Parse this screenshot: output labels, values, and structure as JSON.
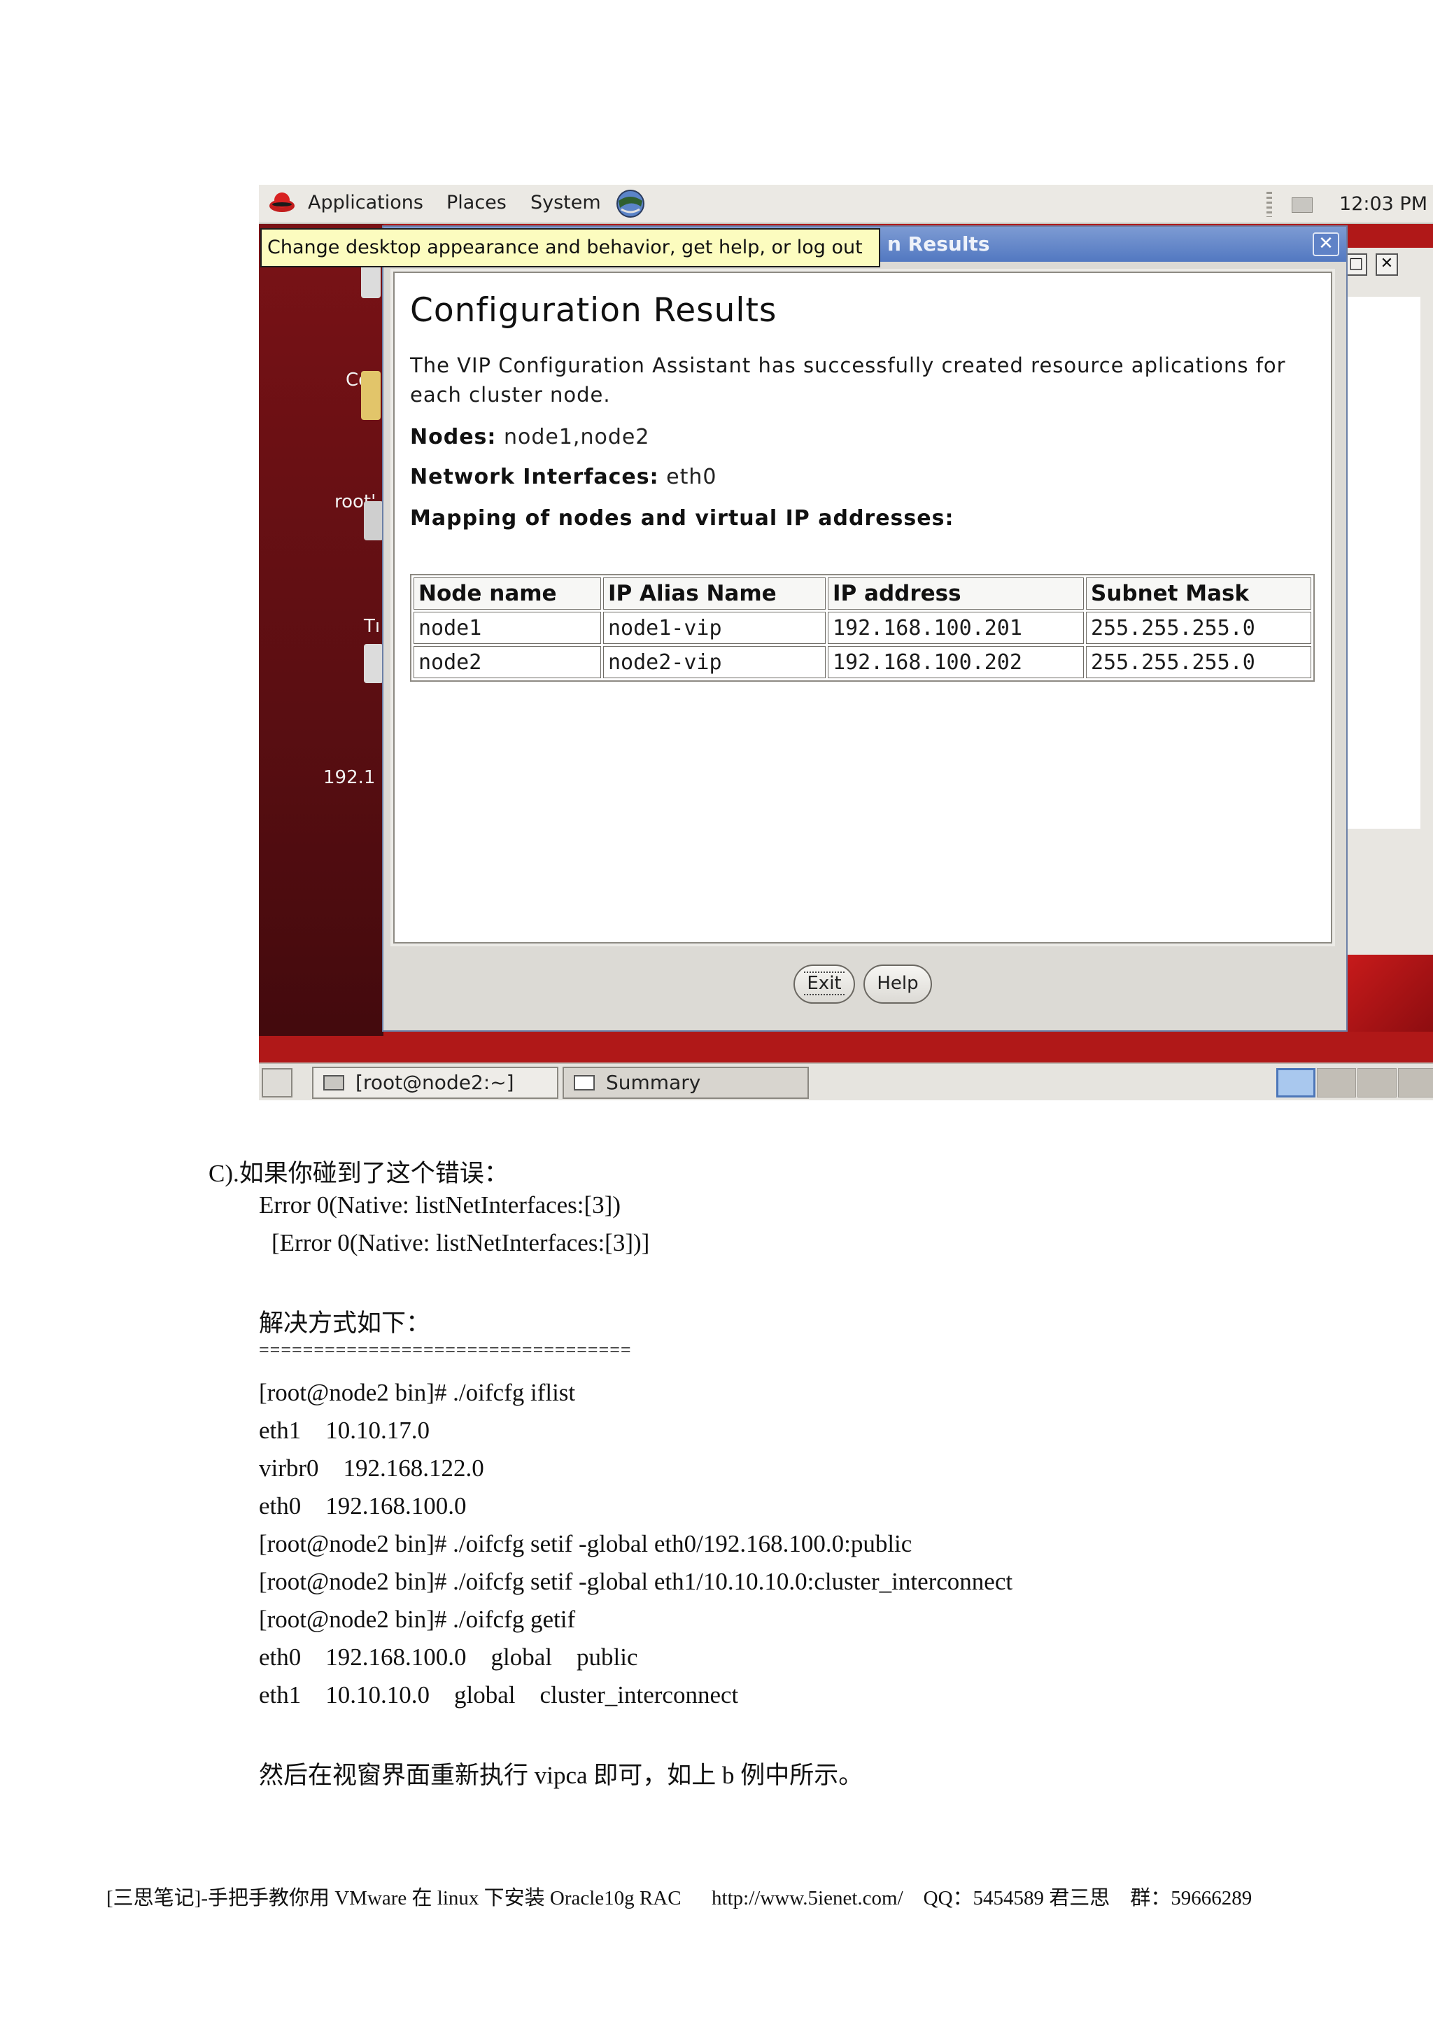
{
  "topbar": {
    "menus": [
      "Applications",
      "Places",
      "System"
    ],
    "clock": "12:03 PM"
  },
  "tooltip": "Change desktop appearance and behavior, get help, or log out",
  "desktop": {
    "labels": [
      "Cor",
      "root'",
      "Tı",
      "192.1"
    ]
  },
  "dialog": {
    "title_fragment": "n Results",
    "close_glyph": "✕",
    "heading": "Configuration Results",
    "description": "The VIP Configuration Assistant has successfully created resource aplications for each cluster node.",
    "nodes_label": "Nodes:",
    "nodes_value": "node1,node2",
    "interfaces_label": "Network Interfaces:",
    "interfaces_value": "eth0",
    "mapping_label": "Mapping of nodes and virtual IP addresses:",
    "table": {
      "headers": [
        "Node name",
        "IP Alias Name",
        "IP address",
        "Subnet Mask"
      ],
      "rows": [
        [
          "node1",
          "node1-vip",
          "192.168.100.201",
          "255.255.255.0"
        ],
        [
          "node2",
          "node2-vip",
          "192.168.100.202",
          "255.255.255.0"
        ]
      ]
    },
    "exit_label": "Exit",
    "help_label": "Help"
  },
  "taskbar": {
    "terminal": "[root@node2:~]",
    "summary": "Summary"
  },
  "doc": {
    "section": "C).如果你碰到了这个错误：",
    "err1": "Error 0(Native: listNetInterfaces:[3])",
    "err2": "[Error 0(Native: listNetInterfaces:[3])]",
    "solution": "解决方式如下：",
    "rule": "==================================",
    "lines": [
      "[root@node2 bin]# ./oifcfg iflist",
      "eth1    10.10.17.0",
      "virbr0    192.168.122.0",
      "eth0    192.168.100.0",
      "[root@node2 bin]# ./oifcfg setif -global eth0/192.168.100.0:public",
      "[root@node2 bin]# ./oifcfg setif -global eth1/10.10.10.0:cluster_interconnect",
      "[root@node2 bin]# ./oifcfg getif",
      "eth0    192.168.100.0    global    public",
      "eth1    10.10.10.0    global    cluster_interconnect"
    ],
    "closing": "然后在视窗界面重新执行 vipca 即可，如上 b 例中所示。"
  },
  "footer": "[三思笔记]-手把手教你用 VMware 在 linux 下安装 Oracle10g RAC      http://www.5ienet.com/    QQ：5454589 君三思    群：59666289"
}
